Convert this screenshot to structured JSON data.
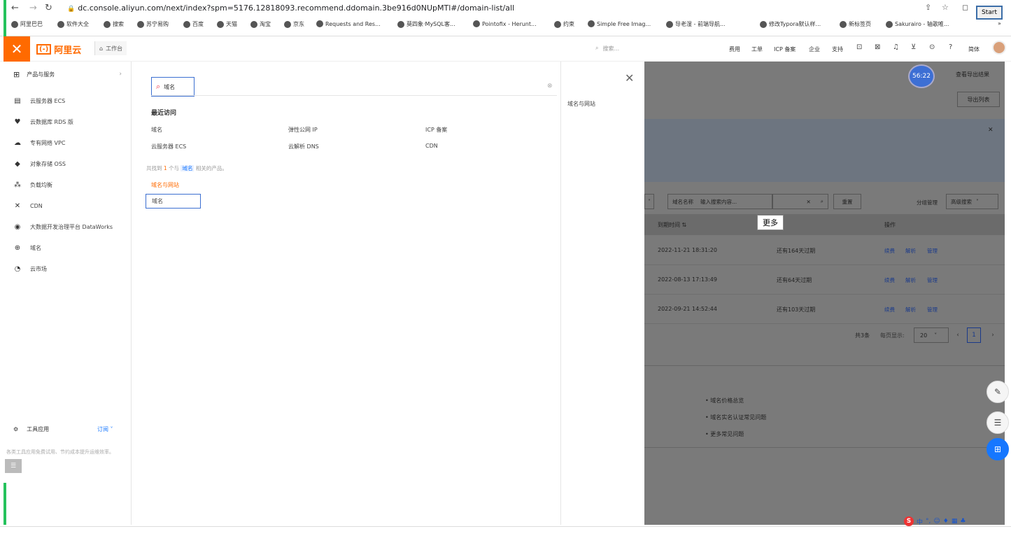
{
  "browser": {
    "url": "dc.console.aliyun.com/next/index?spm=5176.12818093.recommend.ddomain.3be916d0NUpMTl#/domain-list/all",
    "start_label": "Start",
    "bookmarks": [
      "阿里巴巴",
      "软件大全",
      "搜索",
      "苏宁易购",
      "百度",
      "天猫",
      "淘宝",
      "京东",
      "Requests and Res...",
      "莫四象·MySQL客...",
      "Pointofix - Herunt...",
      "约束",
      "Simple Free Imag...",
      "导老湿 - 前端导航...",
      "修改Typora默认样...",
      "新标签页",
      "Sakurairo - 轴歌唯..."
    ]
  },
  "header": {
    "logo_text": "阿里云",
    "workbench_label": "工作台",
    "search_placeholder": "搜索...",
    "links": [
      "费用",
      "工单",
      "ICP 备案",
      "企业",
      "支持"
    ],
    "lang": "简体"
  },
  "sidebar": {
    "head_label": "产品与服务",
    "items": [
      {
        "label": "云服务器 ECS",
        "icon": "server-icon"
      },
      {
        "label": "云数据库 RDS 版",
        "icon": "database-icon"
      },
      {
        "label": "专有网络 VPC",
        "icon": "cloud-icon"
      },
      {
        "label": "对象存储 OSS",
        "icon": "storage-icon"
      },
      {
        "label": "负载均衡",
        "icon": "balance-icon"
      },
      {
        "label": "CDN",
        "icon": "cdn-icon"
      },
      {
        "label": "大数据开发治理平台 DataWorks",
        "icon": "dataworks-icon"
      },
      {
        "label": "域名",
        "icon": "globe-icon"
      },
      {
        "label": "云市场",
        "icon": "market-icon"
      }
    ],
    "tools_label": "工具应用",
    "tools_sub": "订阅",
    "tools_desc": "各类工具应用免费试用、节约成本提升运维效率。"
  },
  "panel": {
    "search_value": "域名",
    "recent_title": "最近访问",
    "recent": [
      "域名",
      "弹性公网 IP",
      "ICP 备案",
      "云服务器 ECS",
      "云解析 DNS",
      "CDN"
    ],
    "found_prefix": "共找到",
    "found_count": "1",
    "found_mid": "个与",
    "found_keyword": "域名",
    "found_suffix": "相关的产品。",
    "category_title": "域名与网站",
    "result_item": "域名",
    "right_title": "域名与网站"
  },
  "background": {
    "timer": "56:22",
    "export_result": "查看导出结果",
    "export_list": "导出列表",
    "filter_label": "域名名称",
    "filter_placeholder": "输入搜索内容...",
    "reset": "重置",
    "group_mgmt": "分组管理",
    "advanced_search": "高级搜索",
    "columns": [
      "到期时间",
      "操作"
    ],
    "rows": [
      {
        "expire": "2022-11-21 18:31:20",
        "status": "还有164天过期"
      },
      {
        "expire": "2022-08-13 17:13:49",
        "status": "还有64天过期"
      },
      {
        "expire": "2022-09-21 14:52:44",
        "status": "还有103天过期"
      }
    ],
    "actions": [
      "续费",
      "解析",
      "管理"
    ],
    "pager_total": "共3条",
    "pager_per": "每页显示:",
    "pager_size": "20",
    "pager_page": "1",
    "faqs": [
      "• 域名价格总览",
      "• 域名实名认证常见问题",
      "• 更多常见问题"
    ]
  },
  "tooltip": "更多",
  "colors": {
    "accent": "#ff6a00",
    "link": "#1677ff",
    "highlight_border": "#3b6fd1"
  }
}
